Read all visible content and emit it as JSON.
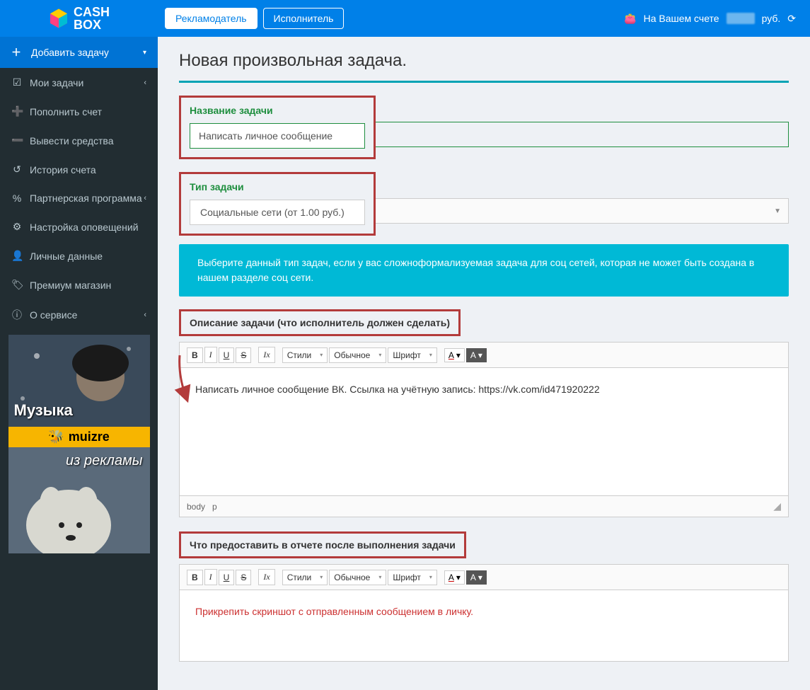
{
  "header": {
    "logo_top": "CASH",
    "logo_bottom": "BOX",
    "btn_advertiser": "Рекламодатель",
    "btn_executor": "Исполнитель",
    "balance_prefix": "На Вашем счете",
    "balance_suffix": "руб."
  },
  "sidebar": {
    "add_task": "Добавить задачу",
    "items": [
      {
        "icon": "☑",
        "label": "Мои задачи",
        "chev": "‹"
      },
      {
        "icon": "➕",
        "label": "Пополнить счет"
      },
      {
        "icon": "➖",
        "label": "Вывести средства"
      },
      {
        "icon": "↺",
        "label": "История счета"
      },
      {
        "icon": "%",
        "label": "Партнерская программа",
        "chev": "‹"
      },
      {
        "icon": "⚙",
        "label": "Настройка оповещений"
      },
      {
        "icon": "👤",
        "label": "Личные данные"
      },
      {
        "icon": "🏷",
        "label": "Премиум магазин"
      },
      {
        "icon": "ⓘ",
        "label": "О сервисе",
        "chev": "‹"
      }
    ],
    "promo_music": "Музыка",
    "promo_brand": "muizre",
    "promo_ads": "из рекламы"
  },
  "page": {
    "title": "Новая произвольная задача.",
    "task_name_label": "Название задачи",
    "task_name_value": "Написать личное сообщение",
    "task_type_label": "Тип задачи",
    "task_type_value": "Социальные сети (от 1.00 руб.)",
    "info_text": "Выберите данный тип задач, если у вас сложноформализуемая задача для соц сетей, которая не может быть создана в нашем разделе соц сети.",
    "desc_heading": "Описание задачи (что исполнитель должен сделать)",
    "desc_body": "Написать личное сообщение ВК. Ссылка на учётную запись: https://vk.com/id471920222",
    "report_heading": "Что предоставить в отчете после выполнения задачи",
    "report_body": "Прикрепить скриншот с отправленным сообщением в личку.",
    "footer_body": "body",
    "footer_p": "p"
  },
  "editor": {
    "bold": "B",
    "italic": "I",
    "under": "U",
    "strike": "S",
    "tx": "Ix",
    "styles": "Стили",
    "normal": "Обычное",
    "font": "Шрифт",
    "a": "A",
    "tri": "▾"
  }
}
